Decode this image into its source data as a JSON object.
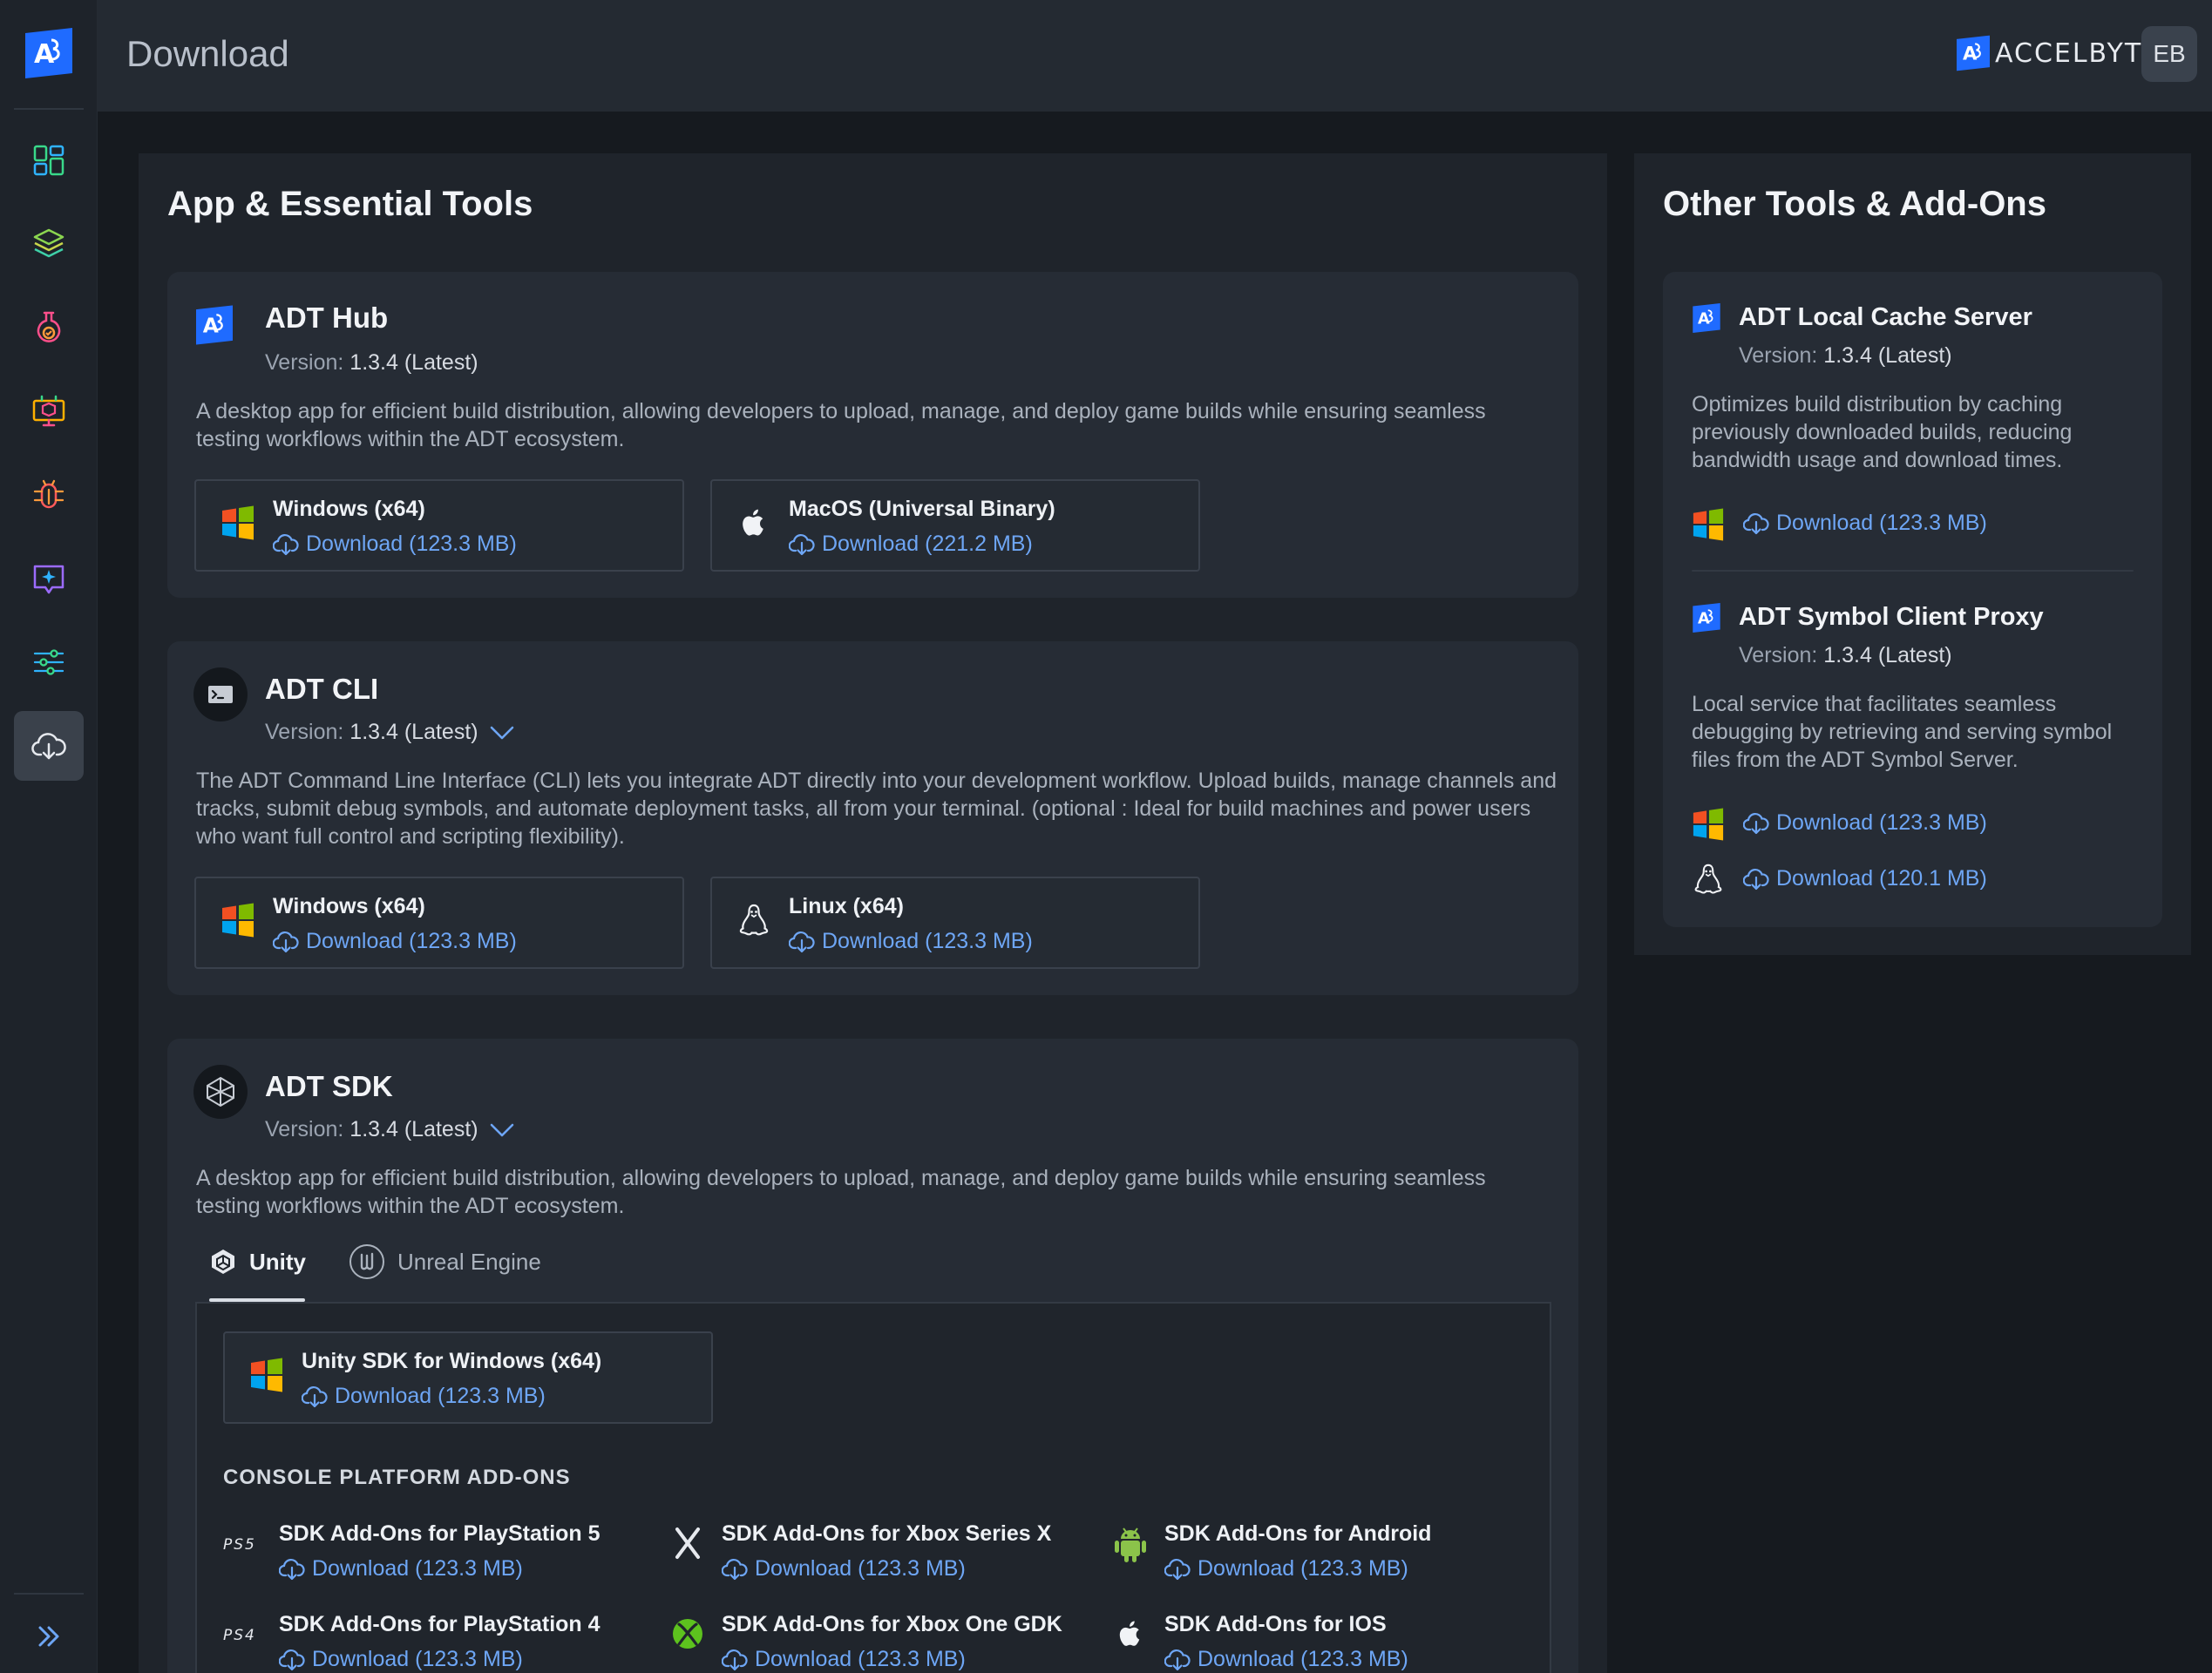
{
  "header": {
    "title": "Download",
    "brand": "ACCELBYTE",
    "avatar_initials": "EB"
  },
  "sidebar": {
    "items": [
      {
        "icon": "dashboard-icon"
      },
      {
        "icon": "layers-icon"
      },
      {
        "icon": "flask-icon"
      },
      {
        "icon": "build-monitor-icon"
      },
      {
        "icon": "bug-icon"
      },
      {
        "icon": "sparkle-chat-icon"
      },
      {
        "icon": "sliders-icon"
      },
      {
        "icon": "cloud-download-icon",
        "active": true
      }
    ]
  },
  "main": {
    "title": "App & Essential Tools",
    "hub": {
      "title": "ADT Hub",
      "version_label": "Version:",
      "version": "1.3.4 (Latest)",
      "desc1": "A desktop app for efficient build distribution, allowing developers to upload, manage, and deploy game builds while ensuring seamless",
      "desc2": "testing workflows within the ADT ecosystem.",
      "downloads": [
        {
          "os": "Windows (x64)",
          "link": "Download (123.3 MB)"
        },
        {
          "os": "MacOS (Universal Binary)",
          "link": "Download (221.2 MB)"
        }
      ]
    },
    "cli": {
      "title": "ADT CLI",
      "version_label": "Version:",
      "version": "1.3.4 (Latest)",
      "desc1": "The ADT Command Line Interface (CLI) lets you integrate ADT directly into your development workflow. Upload builds, manage channels and",
      "desc2": "tracks, submit debug symbols, and automate deployment tasks, all from your terminal. (optional : Ideal for build machines and power users",
      "desc3": "who want full control and scripting flexibility).",
      "downloads": [
        {
          "os": "Windows (x64)",
          "link": "Download (123.3 MB)"
        },
        {
          "os": "Linux (x64)",
          "link": "Download (123.3 MB)"
        }
      ]
    },
    "sdk": {
      "title": "ADT SDK",
      "version_label": "Version:",
      "version": "1.3.4 (Latest)",
      "desc1": "A desktop app for efficient build distribution, allowing developers to upload, manage, and deploy game builds while ensuring seamless",
      "desc2": "testing workflows within the ADT ecosystem.",
      "tabs": [
        "Unity",
        "Unreal Engine"
      ],
      "unity_download": {
        "os": "Unity SDK for Windows (x64)",
        "link": "Download (123.3 MB)"
      },
      "addons_label": "CONSOLE PLATFORM ADD-ONS",
      "addons": [
        {
          "name": "SDK Add-Ons for PlayStation 5",
          "link": "Download (123.3 MB)"
        },
        {
          "name": "SDK Add-Ons for Xbox Series X",
          "link": "Download (123.3 MB)"
        },
        {
          "name": "SDK Add-Ons for Android",
          "link": "Download (123.3 MB)"
        },
        {
          "name": "SDK Add-Ons for PlayStation 4",
          "link": "Download (123.3 MB)"
        },
        {
          "name": "SDK Add-Ons for Xbox One GDK",
          "link": "Download (123.3 MB)"
        },
        {
          "name": "SDK Add-Ons for IOS",
          "link": "Download (123.3 MB)"
        }
      ]
    }
  },
  "side": {
    "title": "Other Tools & Add-Ons",
    "cache": {
      "title": "ADT Local Cache Server",
      "version_label": "Version:",
      "version": "1.3.4 (Latest)",
      "desc1": "Optimizes build distribution by caching",
      "desc2": "previously downloaded builds, reducing",
      "desc3": "bandwidth usage and download times.",
      "link": "Download (123.3 MB)"
    },
    "proxy": {
      "title": "ADT Symbol Client Proxy",
      "version_label": "Version:",
      "version": "1.3.4 (Latest)",
      "desc1": "Local service that facilitates seamless",
      "desc2": "debugging by retrieving and serving symbol",
      "desc3": "files from the ADT Symbol Server.",
      "link_windows": "Download (123.3 MB)",
      "link_linux": "Download (120.1 MB)"
    }
  },
  "colors": {
    "accent": "#6ea6f5",
    "brand_blue": "#1f6bff",
    "active_nav": "#3a414b"
  }
}
